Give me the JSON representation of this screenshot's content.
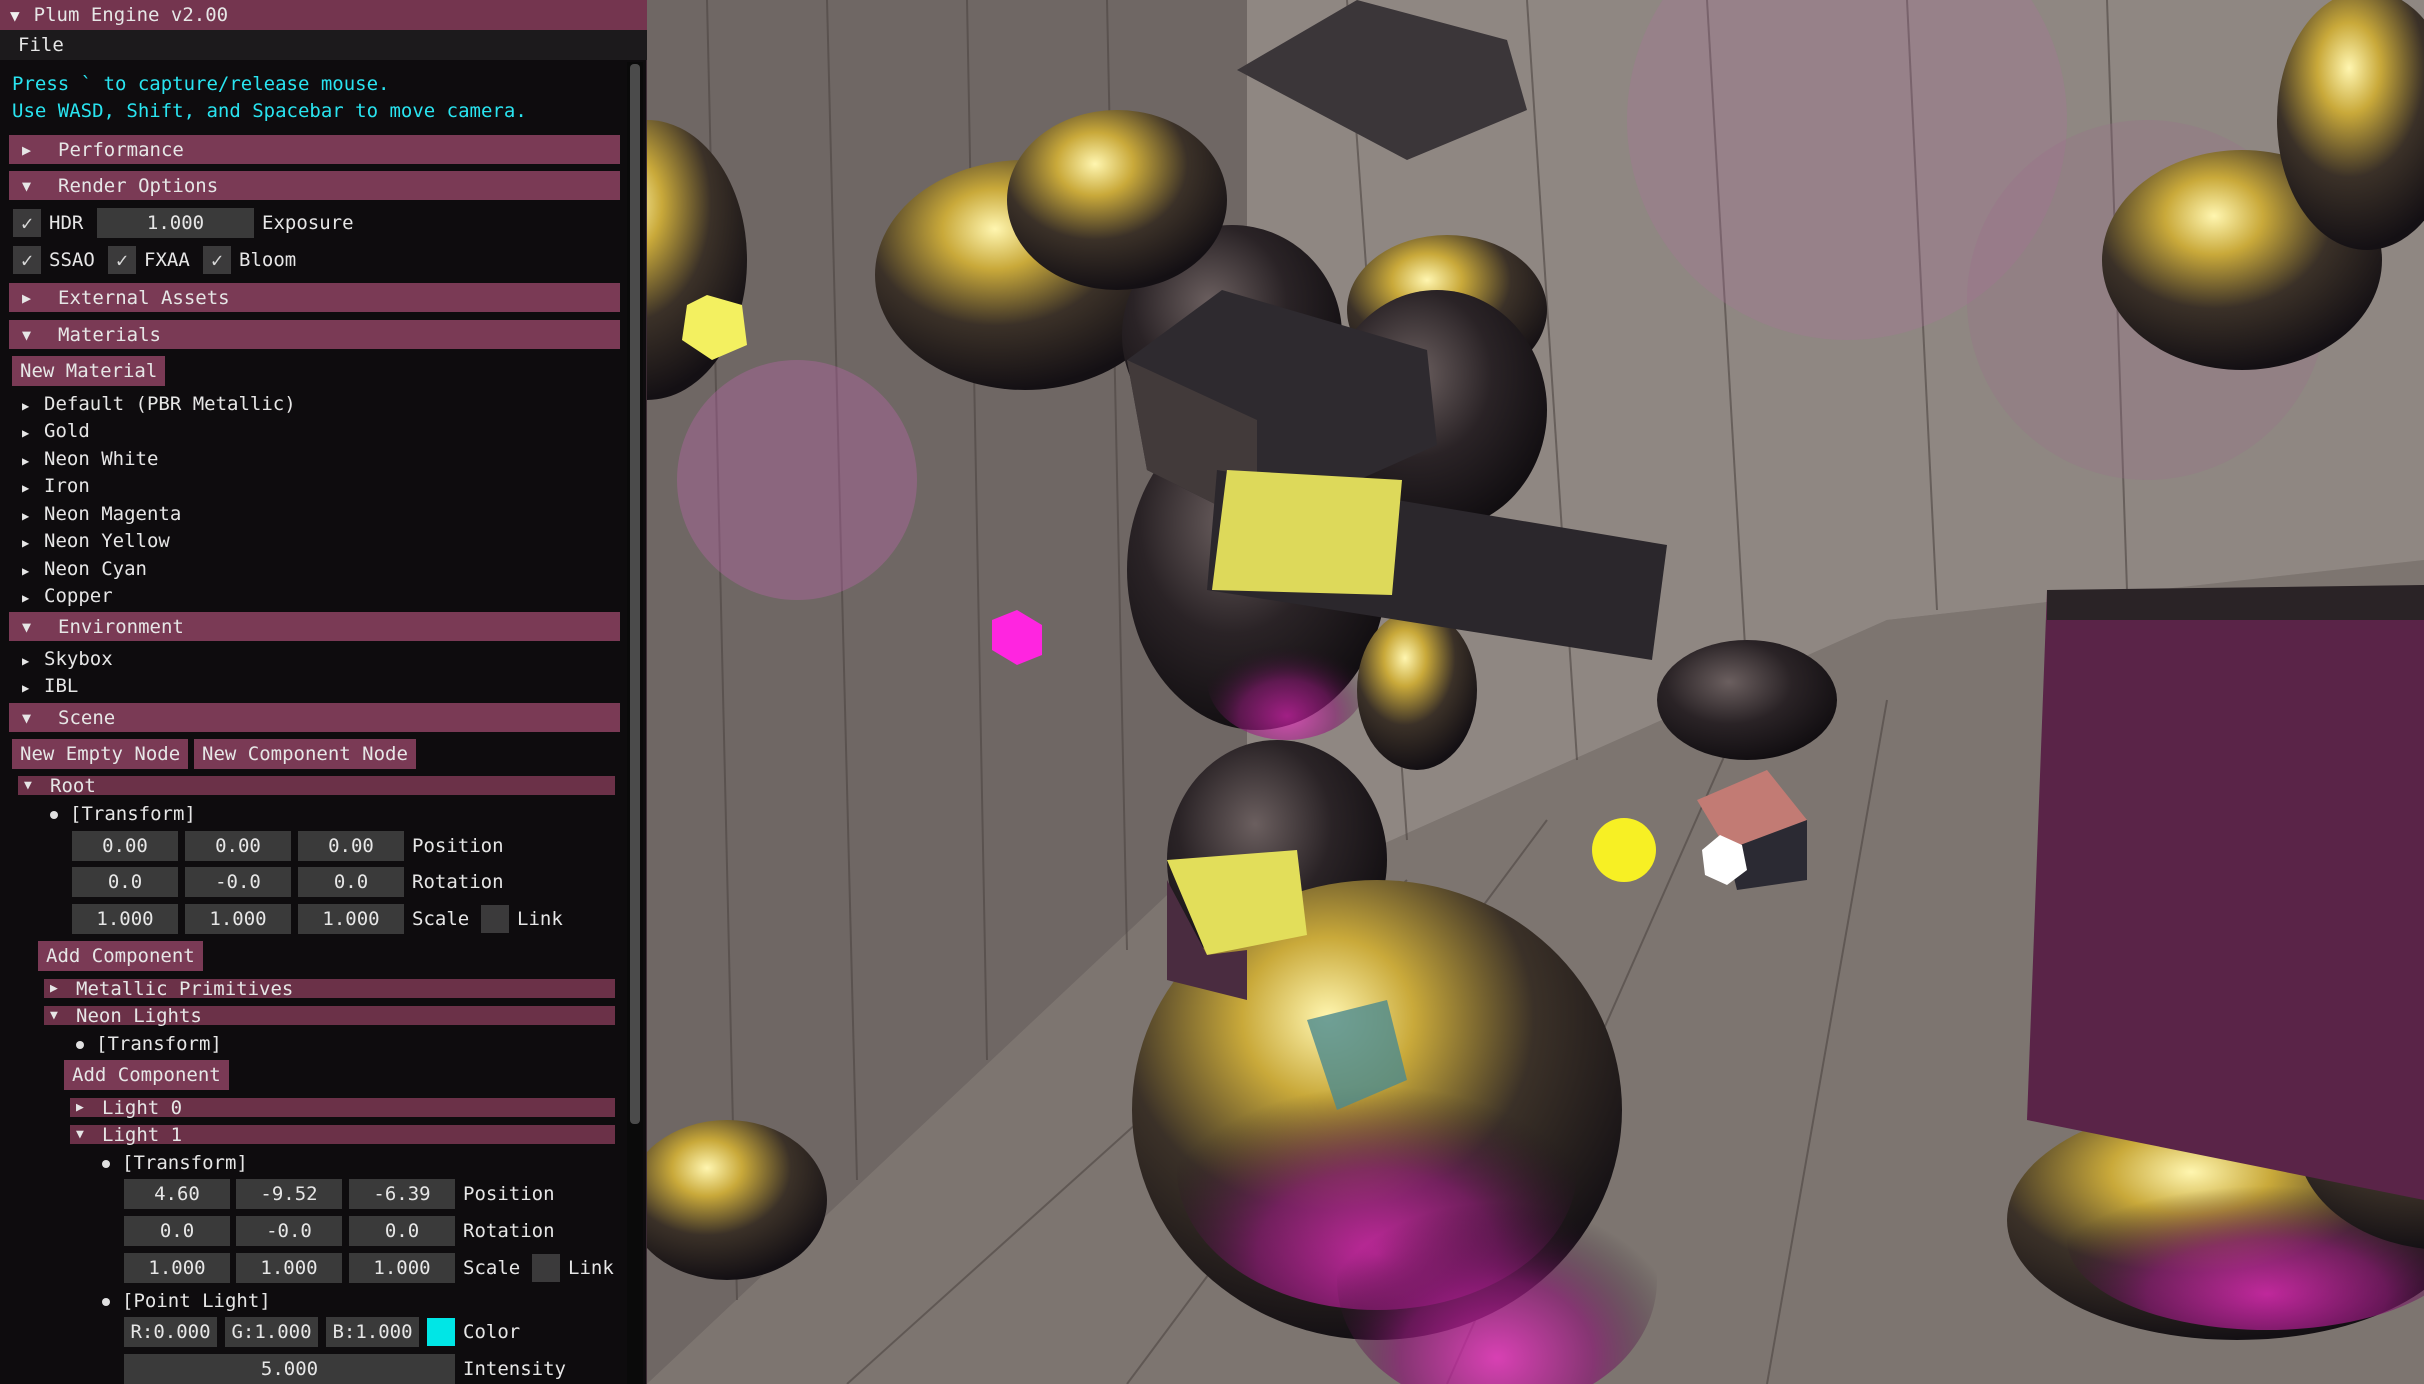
{
  "window": {
    "title": "Plum Engine v2.00"
  },
  "menu": {
    "file": "File"
  },
  "help": {
    "line1": "Press ` to capture/release mouse.",
    "line2": "Use WASD, Shift, and Spacebar to move camera."
  },
  "sections": {
    "performance": "Performance",
    "render_options": "Render Options",
    "external_assets": "External Assets",
    "materials": "Materials",
    "environment": "Environment",
    "scene": "Scene"
  },
  "render": {
    "hdr_label": "HDR",
    "hdr_checked": true,
    "exposure_value": "1.000",
    "exposure_label": "Exposure",
    "ssao_label": "SSAO",
    "fxaa_label": "FXAA",
    "bloom_label": "Bloom"
  },
  "materials": {
    "new_button": "New Material",
    "items": [
      "Default (PBR Metallic)",
      "Gold",
      "Neon White",
      "Iron",
      "Neon Magenta",
      "Neon Yellow",
      "Neon Cyan",
      "Copper"
    ]
  },
  "environment": {
    "items": [
      "Skybox",
      "IBL"
    ]
  },
  "scene": {
    "new_empty_node": "New Empty Node",
    "new_component_node": "New Component Node",
    "root": "Root",
    "transform_label": "[Transform]",
    "root_transform": {
      "position": [
        "0.00",
        "0.00",
        "0.00"
      ],
      "rotation": [
        "0.0",
        "-0.0",
        "0.0"
      ],
      "scale": [
        "1.000",
        "1.000",
        "1.000"
      ]
    },
    "position_label": "Position",
    "rotation_label": "Rotation",
    "scale_label": "Scale",
    "link_label": "Link",
    "add_component": "Add Component",
    "metallic_primitives": "Metallic Primitives",
    "neon_lights": "Neon Lights",
    "light0": "Light 0",
    "light1": "Light 1",
    "light1_transform": {
      "position": [
        "4.60",
        "-9.52",
        "-6.39"
      ],
      "rotation": [
        "0.0",
        "-0.0",
        "0.0"
      ],
      "scale": [
        "1.000",
        "1.000",
        "1.000"
      ]
    },
    "point_light_label": "[Point Light]",
    "color_r": "R:0.000",
    "color_g": "G:1.000",
    "color_b": "B:1.000",
    "color_label": "Color",
    "color_swatch": "#00e6e6",
    "intensity_value": "5.000",
    "intensity_label": "Intensity"
  },
  "theme": {
    "header": "#7a3a55",
    "title": "#74354f",
    "help_text": "#29e4f0"
  }
}
